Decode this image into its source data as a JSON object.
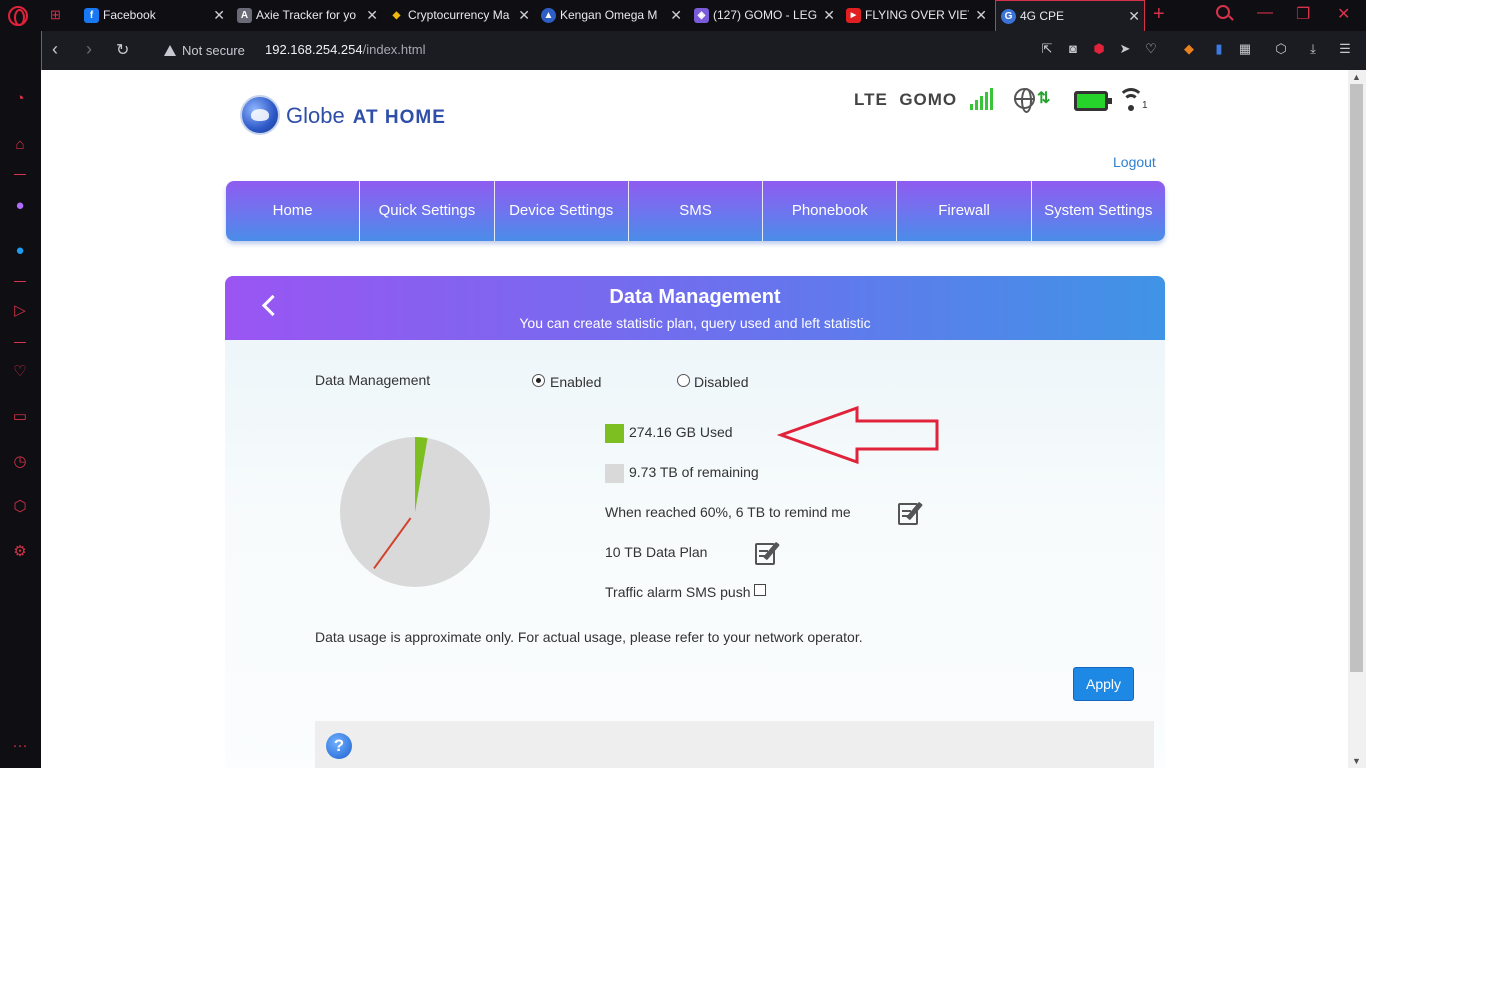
{
  "browser": {
    "tabs": [
      {
        "title": "Facebook",
        "fav_color": "#1877f2",
        "fav_glyph": "f"
      },
      {
        "title": "Axie Tracker for yo",
        "fav_color": "#6b6b78",
        "fav_glyph": "A"
      },
      {
        "title": "Cryptocurrency Ma",
        "fav_color": "#f0b90b",
        "fav_glyph": "◆"
      },
      {
        "title": "Kengan Omega M",
        "fav_color": "#2d5fc4",
        "fav_glyph": "▲"
      },
      {
        "title": "(127) GOMO - LEG",
        "fav_color": "#7a5bd8",
        "fav_glyph": "◈"
      },
      {
        "title": "FLYING OVER VIET",
        "fav_color": "#e02020",
        "fav_glyph": "▶"
      },
      {
        "title": "4G CPE",
        "fav_color": "#3b73d6",
        "fav_glyph": "G"
      }
    ],
    "not_secure": "Not secure",
    "url_host": "192.168.254.254",
    "url_path": "/index.html"
  },
  "header": {
    "brand": "Globe",
    "brand_suffix": "AT HOME",
    "network_type": "LTE",
    "carrier": "GOMO",
    "wifi_clients": "1",
    "logout": "Logout"
  },
  "nav": {
    "items": [
      "Home",
      "Quick Settings",
      "Device Settings",
      "SMS",
      "Phonebook",
      "Firewall",
      "System Settings"
    ]
  },
  "panel": {
    "title": "Data Management",
    "subtitle": "You can create statistic plan, query used and left statistic",
    "field_label": "Data Management",
    "enabled_label": "Enabled",
    "disabled_label": "Disabled",
    "enabled_selected": true,
    "used_label": "274.16 GB Used",
    "remaining_label": "9.73 TB of remaining",
    "reminder_label": "When reached 60%, 6 TB to remind me",
    "plan_label": "10 TB Data Plan",
    "sms_push_label": "Traffic alarm SMS push",
    "note": "Data usage is approximate only. For actual usage, please refer to your network operator.",
    "apply_label": "Apply"
  },
  "usage": {
    "used_fraction": 0.0268,
    "reminder_fraction": 0.6,
    "used_color": "#7dbf21",
    "remaining_color": "#d9d9d9",
    "reminder_color": "#d0422a"
  },
  "colors": {
    "accent": "#1e88e5",
    "annotation_arrow": "#e0223a"
  }
}
